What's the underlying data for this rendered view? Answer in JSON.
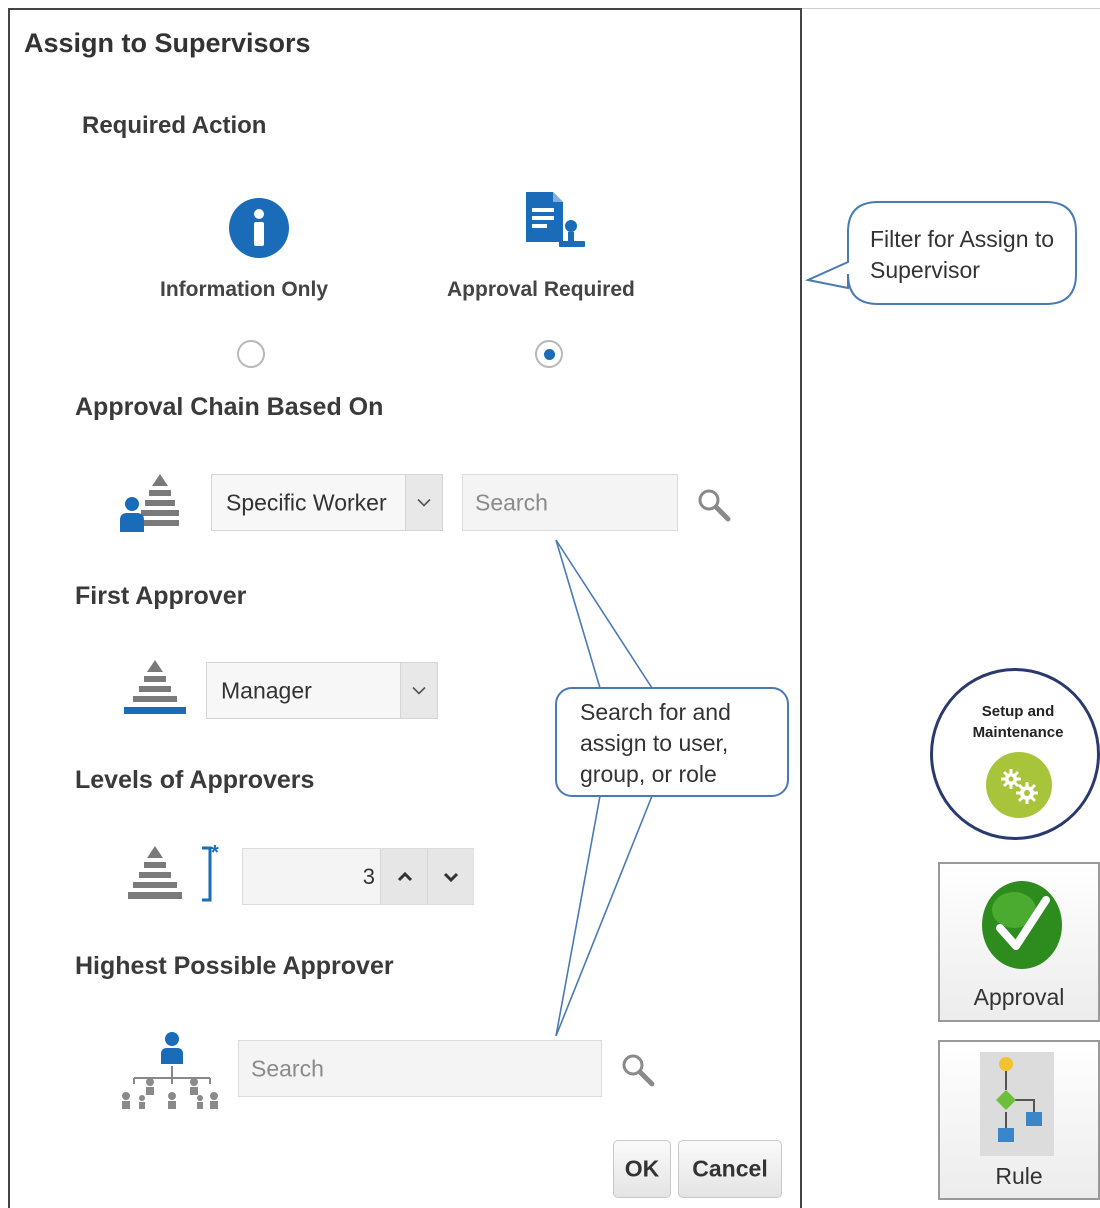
{
  "dialog": {
    "title": "Assign to Supervisors",
    "required_action": {
      "heading": "Required Action",
      "options": [
        {
          "label": "Information Only",
          "icon": "info-icon",
          "selected": false
        },
        {
          "label": "Approval Required",
          "icon": "approval-document-icon",
          "selected": true
        }
      ]
    },
    "approval_chain": {
      "heading": "Approval Chain Based On",
      "select_value": "Specific Worker",
      "search_placeholder": "Search"
    },
    "first_approver": {
      "heading": "First Approver",
      "select_value": "Manager"
    },
    "levels": {
      "heading": "Levels of Approvers",
      "required_marker": "*",
      "value": "3"
    },
    "highest_approver": {
      "heading": "Highest Possible Approver",
      "search_placeholder": "Search"
    },
    "buttons": {
      "ok": "OK",
      "cancel": "Cancel"
    }
  },
  "callouts": {
    "filter": "Filter for Assign to Supervisor",
    "search": "Search for and assign to user, group, or role"
  },
  "side": {
    "setup": "Setup and Maintenance",
    "approval": "Approval",
    "rule": "Rule"
  },
  "colors": {
    "accent_blue": "#1a6bb8",
    "icon_gray": "#7a7a7a",
    "check_green": "#2e8b1e",
    "setup_green": "#a7c43a"
  }
}
